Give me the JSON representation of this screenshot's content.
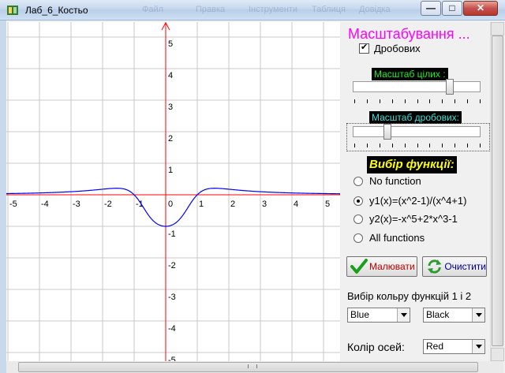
{
  "window": {
    "title": "Лаб_6_Костьо",
    "menu_ghost": [
      "Файл",
      "Правка",
      "Інструменти",
      "Таблиця",
      "Довідка"
    ],
    "buttons": {
      "minimize": "—",
      "maximize": "□",
      "close": "✕"
    }
  },
  "panel": {
    "title": "Масштабування ...",
    "fraction_checkbox": {
      "label": "Дробових",
      "checked": true
    },
    "int_scale_label": "Масштаб цілих :",
    "int_scale_value": 0.77,
    "frac_scale_label": "Масштаб дробових:",
    "frac_scale_value": 0.22,
    "func_select_label": "Вибір функції:",
    "functions": [
      {
        "label": "No function",
        "selected": false
      },
      {
        "label": "y1(x)=(x^2-1)/(x^4+1)",
        "selected": true
      },
      {
        "label": "y2(x)=-x^5+2*x^3-1",
        "selected": false
      },
      {
        "label": "All functions",
        "selected": false
      }
    ],
    "draw_button": "Малювати",
    "clear_button": "Очистити",
    "color_label": "Вибір кольру функцій 1 і 2",
    "color1": "Blue",
    "color2": "Black",
    "axes_label": "Колір осей:",
    "axes_color": "Red"
  },
  "chart_data": {
    "type": "line",
    "x_ticks": [
      "-5",
      "-4",
      "-3",
      "-2",
      "-1",
      "0",
      "1",
      "2",
      "3",
      "4",
      "5"
    ],
    "y_ticks": [
      "5",
      "4",
      "3",
      "2",
      "1",
      "-1",
      "-2",
      "-3",
      "-4",
      "-5"
    ],
    "xlim": [
      -5,
      5
    ],
    "ylim": [
      -5,
      5
    ],
    "grid": true,
    "axis_color": "#ff0000",
    "series": [
      {
        "function": "y1(x)=(x^2-1)/(x^4+1)",
        "color": "#0000ff"
      }
    ]
  }
}
